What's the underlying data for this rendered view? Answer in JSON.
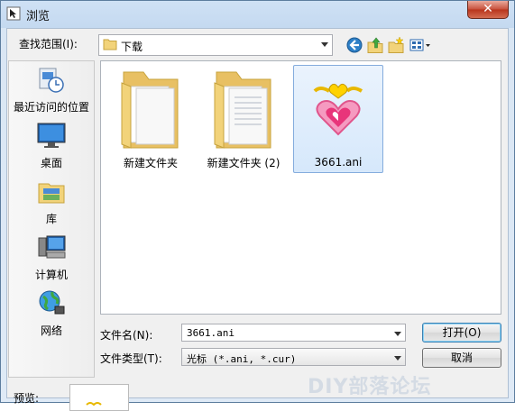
{
  "window": {
    "title": "浏览",
    "close_label": "✕"
  },
  "toolbar": {
    "lookin_label": "查找范围(I):",
    "lookin_value": "下载"
  },
  "places": [
    {
      "label": "最近访问的位置",
      "icon": "recent-places-icon"
    },
    {
      "label": "桌面",
      "icon": "desktop-icon"
    },
    {
      "label": "库",
      "icon": "libraries-icon"
    },
    {
      "label": "计算机",
      "icon": "computer-icon"
    },
    {
      "label": "网络",
      "icon": "network-icon"
    }
  ],
  "files": [
    {
      "label": "新建文件夹",
      "icon": "folder-icon"
    },
    {
      "label": "新建文件夹 (2)",
      "icon": "folder-icon"
    },
    {
      "label": "3661.ani",
      "icon": "animated-cursor-icon",
      "selected": true
    }
  ],
  "form": {
    "filename_label": "文件名(N):",
    "filename_value": "3661.ani",
    "filetype_label": "文件类型(T):",
    "filetype_value": "光标 (*.ani, *.cur)"
  },
  "buttons": {
    "open_label": "打开(O)",
    "cancel_label": "取消"
  },
  "preview": {
    "label": "预览:"
  },
  "watermark": "DIY部落论坛",
  "colors": {
    "selection": "#d6e8fb",
    "selection_border": "#84acdd",
    "close_button": "#c7503b",
    "folder": "#f2d37a"
  }
}
